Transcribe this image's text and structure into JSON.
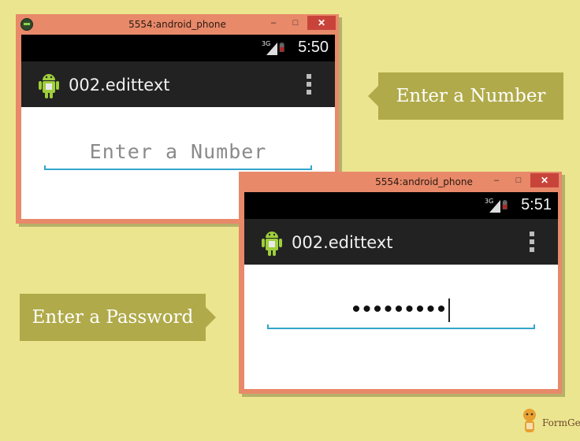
{
  "window1": {
    "title": "5554:android_phone",
    "controls": {
      "minimize": "–",
      "maximize": "□",
      "close": "✕"
    },
    "status_time": "5:50",
    "signal": "3G",
    "app_title": "002.edittext",
    "input_hint": "Enter a Number"
  },
  "window2": {
    "title": "5554:android_phone",
    "controls": {
      "minimize": "–",
      "maximize": "□",
      "close": "✕"
    },
    "status_time": "5:51",
    "signal": "3G",
    "app_title": "002.edittext",
    "password_value": "•••••••••"
  },
  "callouts": {
    "number_label": "Enter a Number",
    "password_label": "Enter a Password"
  },
  "branding": {
    "name": "FormGet"
  },
  "colors": {
    "background": "#ece58f",
    "window_frame": "#e8896a",
    "action_bar": "#222222",
    "accent_underline": "#33a5cc",
    "callout": "#b0aa4a"
  }
}
